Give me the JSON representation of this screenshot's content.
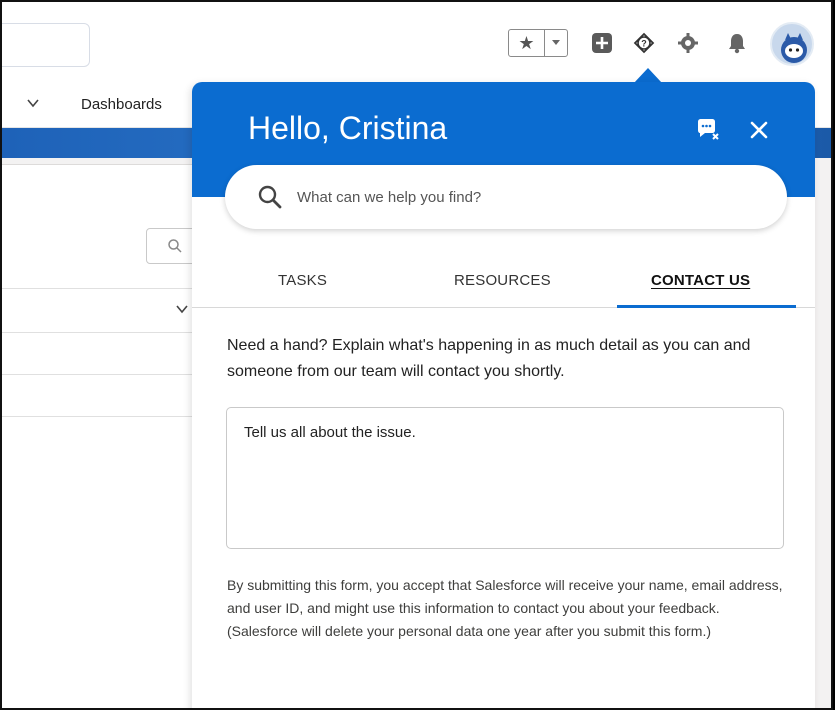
{
  "nav": {
    "dashboards_label": "Dashboards"
  },
  "icons": {
    "favorites": "star-icon",
    "favorites_menu": "caret-down-icon",
    "new": "plus-icon",
    "help": "help-icon",
    "setup": "gear-icon",
    "notifications": "bell-icon",
    "search": "search-icon",
    "close": "close-icon",
    "chat": "chat-icon"
  },
  "colors": {
    "panel_header": "#0b6cd0",
    "accent": "#0b6cd0",
    "banner": "#1e62b8"
  },
  "help_panel": {
    "greeting": "Hello, Cristina",
    "search_placeholder": "What can we help you find?",
    "tabs": [
      {
        "label": "TASKS",
        "active": false
      },
      {
        "label": "RESOURCES",
        "active": false
      },
      {
        "label": "CONTACT US",
        "active": true
      }
    ],
    "intro": "Need a hand? Explain what's happening in as much detail as you can and someone from our team will contact you shortly.",
    "issue_placeholder": "Tell us all about the issue.",
    "disclaimer": "By submitting this form, you accept that Salesforce will receive your name, email address, and user ID, and might use this information to contact you about your feedback. (Salesforce will delete your personal data one year after you submit this form.)"
  }
}
